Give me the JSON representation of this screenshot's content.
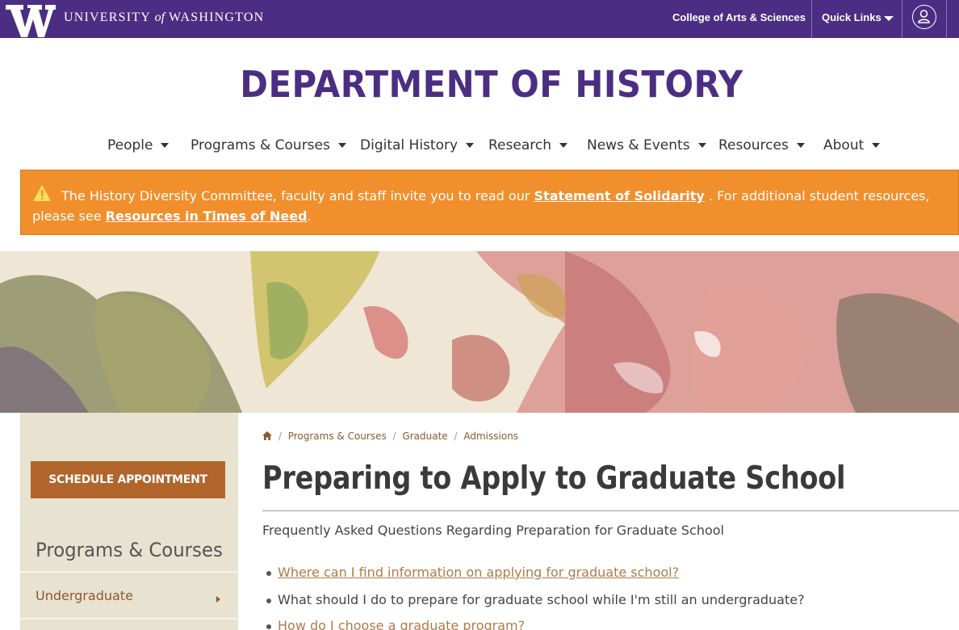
{
  "topbar": {
    "wordmark": "W",
    "university_name_pre": "UNIVERSITY",
    "university_name_of": "of",
    "university_name_post": "WASHINGTON",
    "college_link": "College of Arts & Sciences",
    "quick_links": "Quick Links",
    "user_icon": "user-icon",
    "colors": {
      "bar": "#4b2e83",
      "text": "#ffffff"
    }
  },
  "header": {
    "department_title": "DEPARTMENT OF HISTORY"
  },
  "nav": {
    "items": [
      {
        "label": "People"
      },
      {
        "label": "Programs & Courses"
      },
      {
        "label": "Digital History"
      },
      {
        "label": "Research"
      },
      {
        "label": "News & Events"
      },
      {
        "label": "Resources"
      },
      {
        "label": "About"
      }
    ]
  },
  "alert": {
    "icon": "warning-icon",
    "text_before": "The History Diversity Committee, faculty and staff invite you to read our",
    "link1": "Statement of Solidarity",
    "text_middle": ". For additional student resources, please see",
    "link2": "Resources in Times of Need",
    "text_after": ".",
    "color": "#f08f2b"
  },
  "sidebar": {
    "schedule_button": "SCHEDULE APPOINTMENT",
    "section_title": "Programs & Courses",
    "items": [
      {
        "label": "Undergraduate"
      }
    ]
  },
  "breadcrumb": {
    "home_icon": "home-icon",
    "items": [
      "Programs & Courses",
      "Graduate",
      "Admissions"
    ]
  },
  "main": {
    "title": "Preparing to Apply to Graduate School",
    "subtitle": "Frequently Asked Questions Regarding Preparation for Graduate School",
    "faq": [
      {
        "text": "Where can I find information on applying for graduate school?",
        "is_link": true
      },
      {
        "text": "What should I do to prepare for graduate school while I'm still an undergraduate?",
        "is_link": false
      },
      {
        "text": "How do I choose a graduate program?",
        "is_link": false
      }
    ]
  }
}
